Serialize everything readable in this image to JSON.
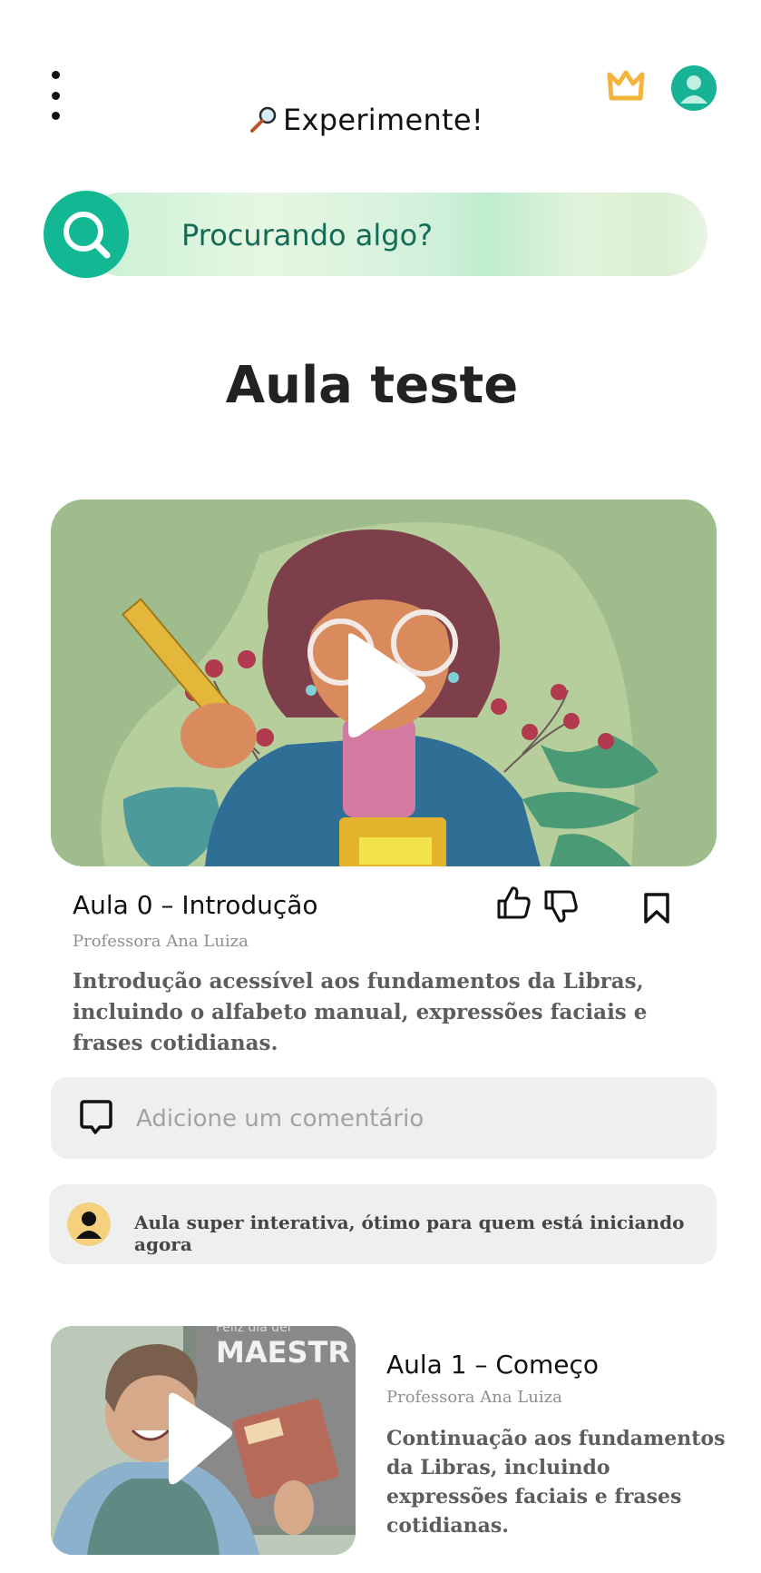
{
  "header": {
    "brand_label": "Experimente!",
    "menu_icon": "more-vertical-icon",
    "premium_icon": "crown-icon",
    "profile_icon": "user-avatar-icon"
  },
  "search": {
    "placeholder": "Procurando algo?",
    "icon": "search-icon"
  },
  "page": {
    "title": "Aula teste"
  },
  "lessons": [
    {
      "title": "Aula 0 – Introdução",
      "teacher": "Professora Ana Luiza",
      "description": "Introdução acessível aos fundamentos da Libras, incluindo o alfabeto manual, expressões faciais e frases cotidianas."
    },
    {
      "title": "Aula 1 – Começo",
      "teacher": "Professora Ana Luiza",
      "description": "Continuação aos fundamentos da Libras, incluindo expressões faciais e frases cotidianas.",
      "thumbnail_text_small": "Feliz dia del",
      "thumbnail_text_big": "MAESTR"
    }
  ],
  "comment_input": {
    "placeholder": "Adicione um comentário"
  },
  "comments": [
    {
      "text": "Aula super interativa, ótimo para quem está iniciando agora"
    }
  ],
  "colors": {
    "accent": "#12b894",
    "crown": "#f2b43c",
    "hero_bg": "#9fbd8c",
    "card_bg": "#efefef"
  }
}
